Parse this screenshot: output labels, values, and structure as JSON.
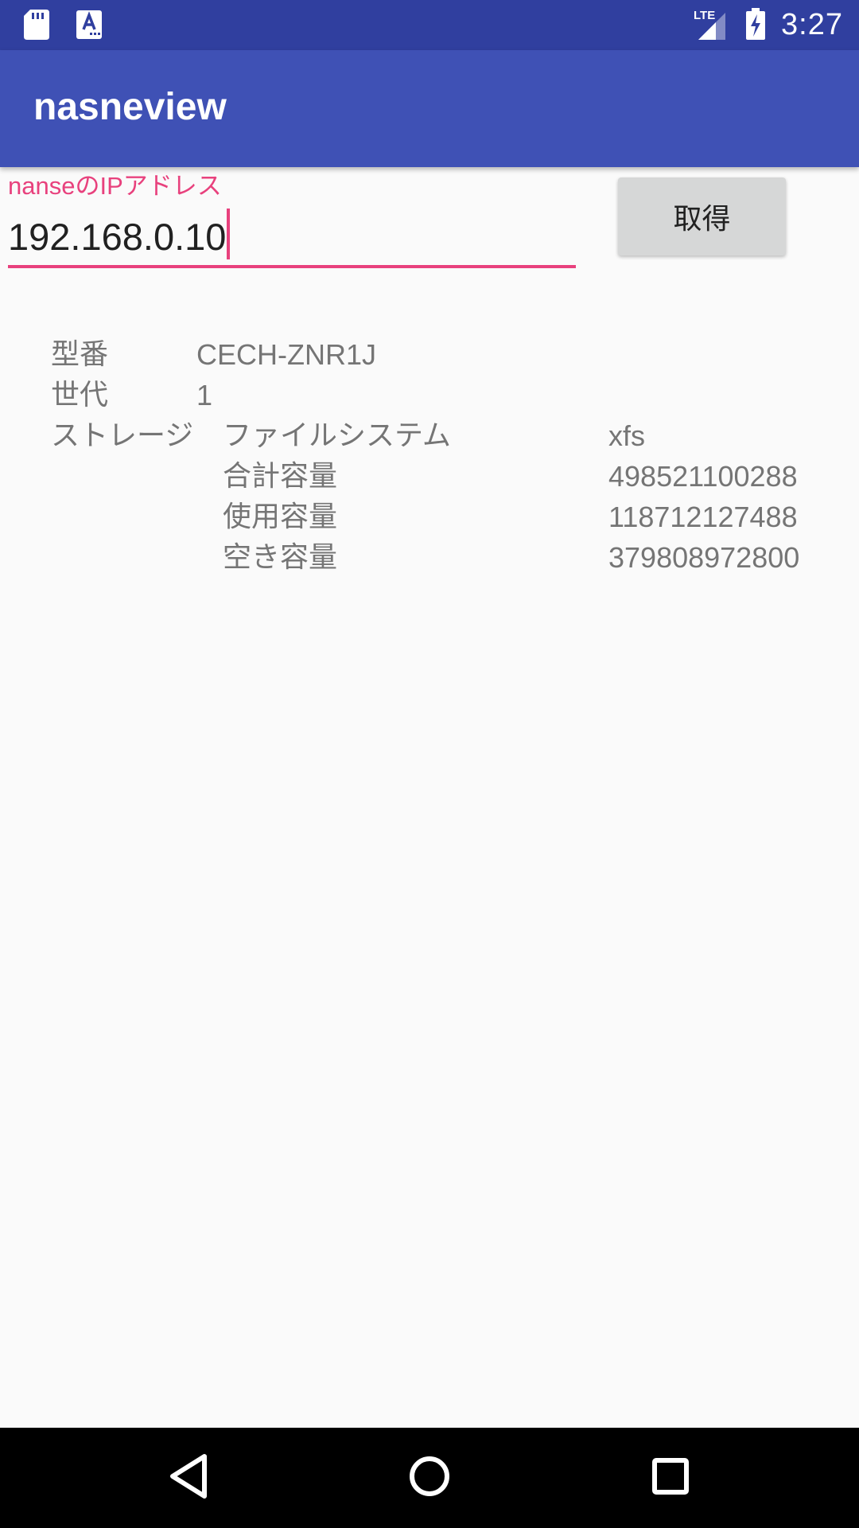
{
  "status_bar": {
    "time": "3:27",
    "icons": [
      "sd-card-icon",
      "keyboard-a-icon",
      "lte-signal-icon",
      "battery-charging-icon"
    ]
  },
  "app_bar": {
    "title": "nasneview"
  },
  "ip_field": {
    "label": "nanseのIPアドレス",
    "value": "192.168.0.10"
  },
  "get_button": {
    "label": "取得"
  },
  "info": {
    "model_label": "型番",
    "model_value": "CECH-ZNR1J",
    "generation_label": "世代",
    "generation_value": "1",
    "storage_label": "ストレージ",
    "storage_rows": [
      {
        "label": "ファイルシステム",
        "value": "xfs"
      },
      {
        "label": "合計容量",
        "value": "498521100288"
      },
      {
        "label": "使用容量",
        "value": "118712127488"
      },
      {
        "label": "空き容量",
        "value": "379808972800"
      }
    ]
  },
  "nav_bar": {
    "icons": [
      "back-icon",
      "home-icon",
      "recents-icon"
    ]
  },
  "colors": {
    "status_bar": "#303f9f",
    "app_bar": "#3f51b5",
    "accent": "#e8417d",
    "background": "#fafafa"
  }
}
